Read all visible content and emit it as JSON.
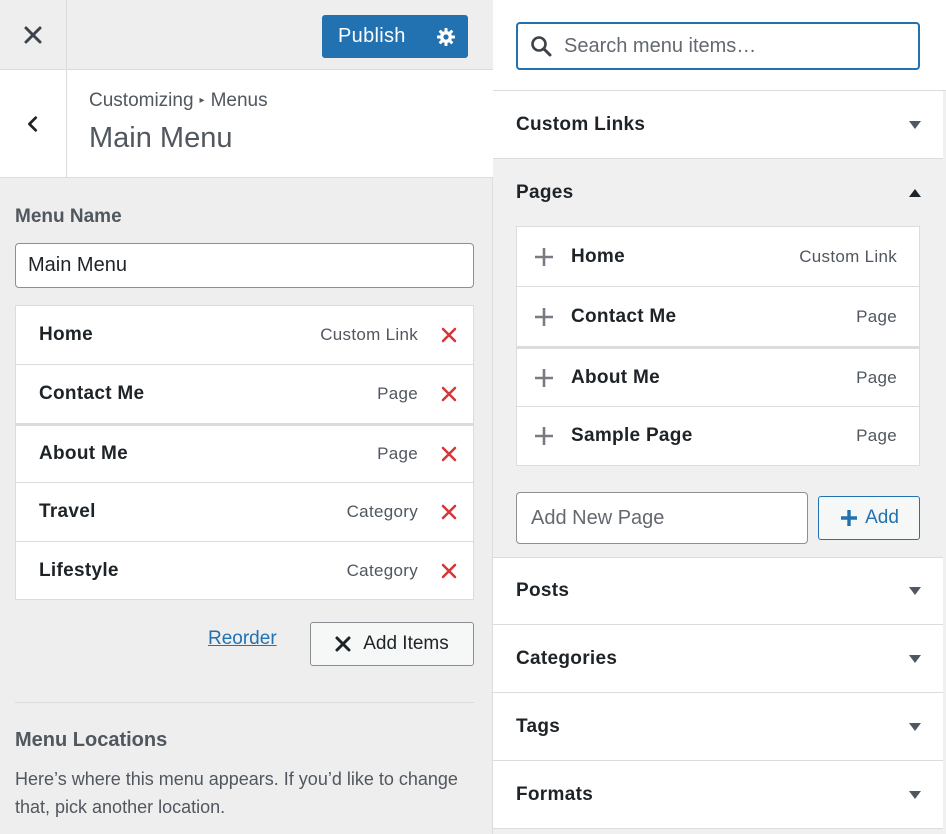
{
  "left": {
    "publish_label": "Publish",
    "breadcrumb": {
      "root": "Customizing",
      "separator": "▸",
      "current": "Menus"
    },
    "section_title": "Main Menu",
    "menu_name_label": "Menu Name",
    "menu_name_value": "Main Menu",
    "menu_items": [
      {
        "title": "Home",
        "type": "Custom Link"
      },
      {
        "title": "Contact Me",
        "type": "Page"
      },
      {
        "title": "About Me",
        "type": "Page"
      },
      {
        "title": "Travel",
        "type": "Category"
      },
      {
        "title": "Lifestyle",
        "type": "Category"
      }
    ],
    "reorder_label": "Reorder",
    "add_items_label": "Add Items",
    "locations_title": "Menu Locations",
    "locations_desc": "Here’s where this menu appears. If you’d like to change that, pick another location."
  },
  "right": {
    "search_placeholder": "Search menu items…",
    "sections": {
      "custom_links": "Custom Links",
      "pages": "Pages",
      "posts": "Posts",
      "categories": "Categories",
      "tags": "Tags",
      "formats": "Formats"
    },
    "pages": [
      {
        "title": "Home",
        "type": "Custom Link"
      },
      {
        "title": "Contact Me",
        "type": "Page"
      },
      {
        "title": "About Me",
        "type": "Page"
      },
      {
        "title": "Sample Page",
        "type": "Page"
      }
    ],
    "new_page_placeholder": "Add New Page",
    "add_label": "Add"
  },
  "colors": {
    "accent": "#2271b1",
    "remove": "#d63638",
    "panel": "#eeeeee"
  },
  "icons": [
    "close-icon",
    "gear-icon",
    "back-chevron-icon",
    "remove-icon",
    "search-icon",
    "plus-icon",
    "caret-down-icon",
    "caret-up-icon"
  ]
}
